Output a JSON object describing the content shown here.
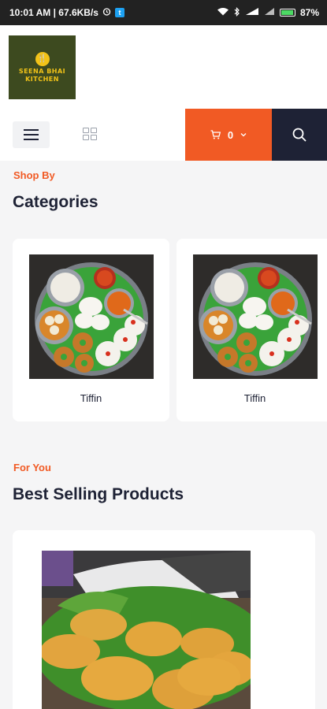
{
  "status_bar": {
    "time_info": "10:01 AM | 67.6KB/s",
    "battery": "87%",
    "battery_level": 0.87
  },
  "brand": {
    "logo_line1": "SEENA BHAI",
    "logo_line2": "KITCHEN"
  },
  "nav": {
    "cart_count": "0",
    "icons": [
      "menu-icon",
      "grid-icon",
      "cart-icon",
      "chevron-down-icon",
      "search-icon"
    ]
  },
  "categories_section": {
    "eyebrow": "Shop By",
    "title": "Categories",
    "items": [
      {
        "label": "Tiffin"
      },
      {
        "label": "Tiffin"
      }
    ]
  },
  "products_section": {
    "eyebrow": "For You",
    "title": "Best Selling Products"
  },
  "colors": {
    "accent": "#f15a24",
    "navy": "#1e2235",
    "logo_bg": "#3d4a1f",
    "logo_text": "#f2c318"
  }
}
